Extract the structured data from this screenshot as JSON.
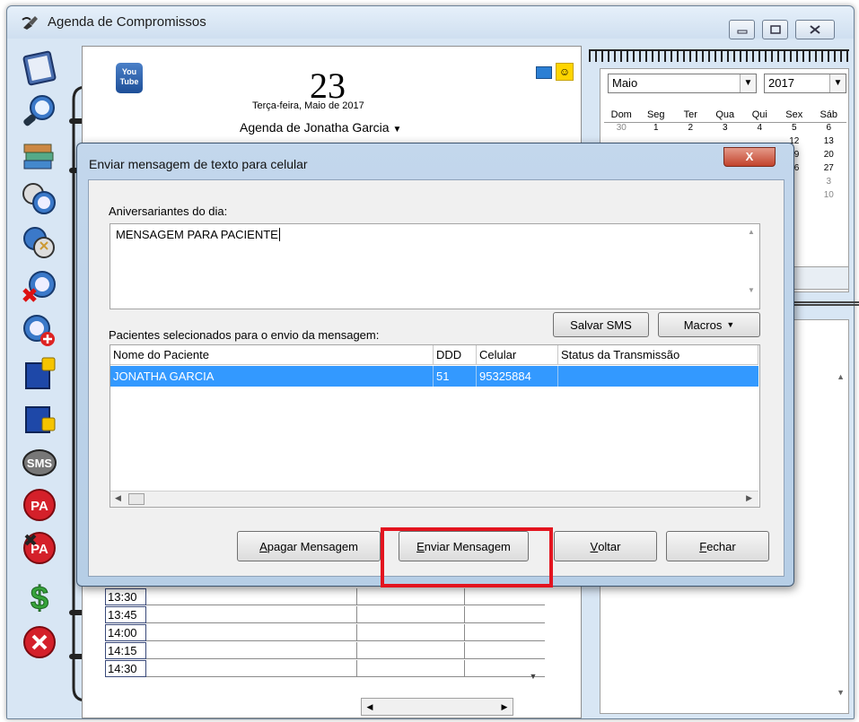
{
  "window": {
    "title": "Agenda de Compromissos",
    "minimize_icon": "minimize-icon",
    "maximize_icon": "maximize-icon",
    "close_icon": "close-icon"
  },
  "toolbar": {
    "icons": [
      "address-book-icon",
      "search-clock-icon",
      "books-icon",
      "clock-search-icon",
      "clock-arrows-icon",
      "clock-delete-icon",
      "clock-add-icon",
      "book-lock-icon",
      "book-lock-2-icon",
      "sms-icon",
      "pa-icon",
      "pa-delete-icon",
      "dollar-icon",
      "exit-icon"
    ],
    "sms_label": "SMS",
    "pa_label": "PA"
  },
  "diary": {
    "youtube_label_top": "You",
    "youtube_label_bottom": "Tube",
    "day": "23",
    "date_text": "Terça-feira, Maio de 2017",
    "owner": "Agenda de Jonatha Garcia",
    "times": [
      "13:30",
      "13:45",
      "14:00",
      "14:15",
      "14:30"
    ]
  },
  "calendar": {
    "month": "Maio",
    "year": "2017",
    "weekdays": [
      "Dom",
      "Seg",
      "Ter",
      "Qua",
      "Qui",
      "Sex",
      "Sáb"
    ],
    "weeks": [
      [
        "30",
        "1",
        "2",
        "3",
        "4",
        "5",
        "6"
      ],
      [
        "",
        "",
        "",
        "",
        "",
        "12",
        "13"
      ],
      [
        "",
        "",
        "",
        "",
        "",
        "19",
        "20"
      ],
      [
        "",
        "",
        "",
        "",
        "",
        "26",
        "27"
      ],
      [
        "",
        "",
        "",
        "",
        "",
        "",
        "3"
      ],
      [
        "",
        "",
        "",
        "",
        "",
        "",
        "10"
      ]
    ]
  },
  "dialog": {
    "title": "Enviar mensagem de texto para celular",
    "close_label": "X",
    "birthdays_label": "Aniversariantes do dia:",
    "message_text": "MENSAGEM PARA PACIENTE",
    "patients_label": "Pacientes selecionados para o envio da mensagem:",
    "save_sms_label": "Salvar SMS",
    "macros_label": "Macros",
    "columns": [
      "Nome do Paciente",
      "DDD",
      "Celular",
      "Status da Transmissão"
    ],
    "rows": [
      {
        "name": "JONATHA GARCIA",
        "ddd": "51",
        "phone": "95325884",
        "status": ""
      }
    ],
    "buttons": {
      "delete_prefix": "A",
      "delete_rest": "pagar Mensagem",
      "send_prefix": "E",
      "send_rest": "nviar Mensagem",
      "back_prefix": "V",
      "back_rest": "oltar",
      "close_prefix": "F",
      "close_rest": "echar"
    }
  },
  "colors": {
    "selection": "#3399ff",
    "highlight": "#e3141f",
    "window_frame": "#d8e6f4"
  }
}
